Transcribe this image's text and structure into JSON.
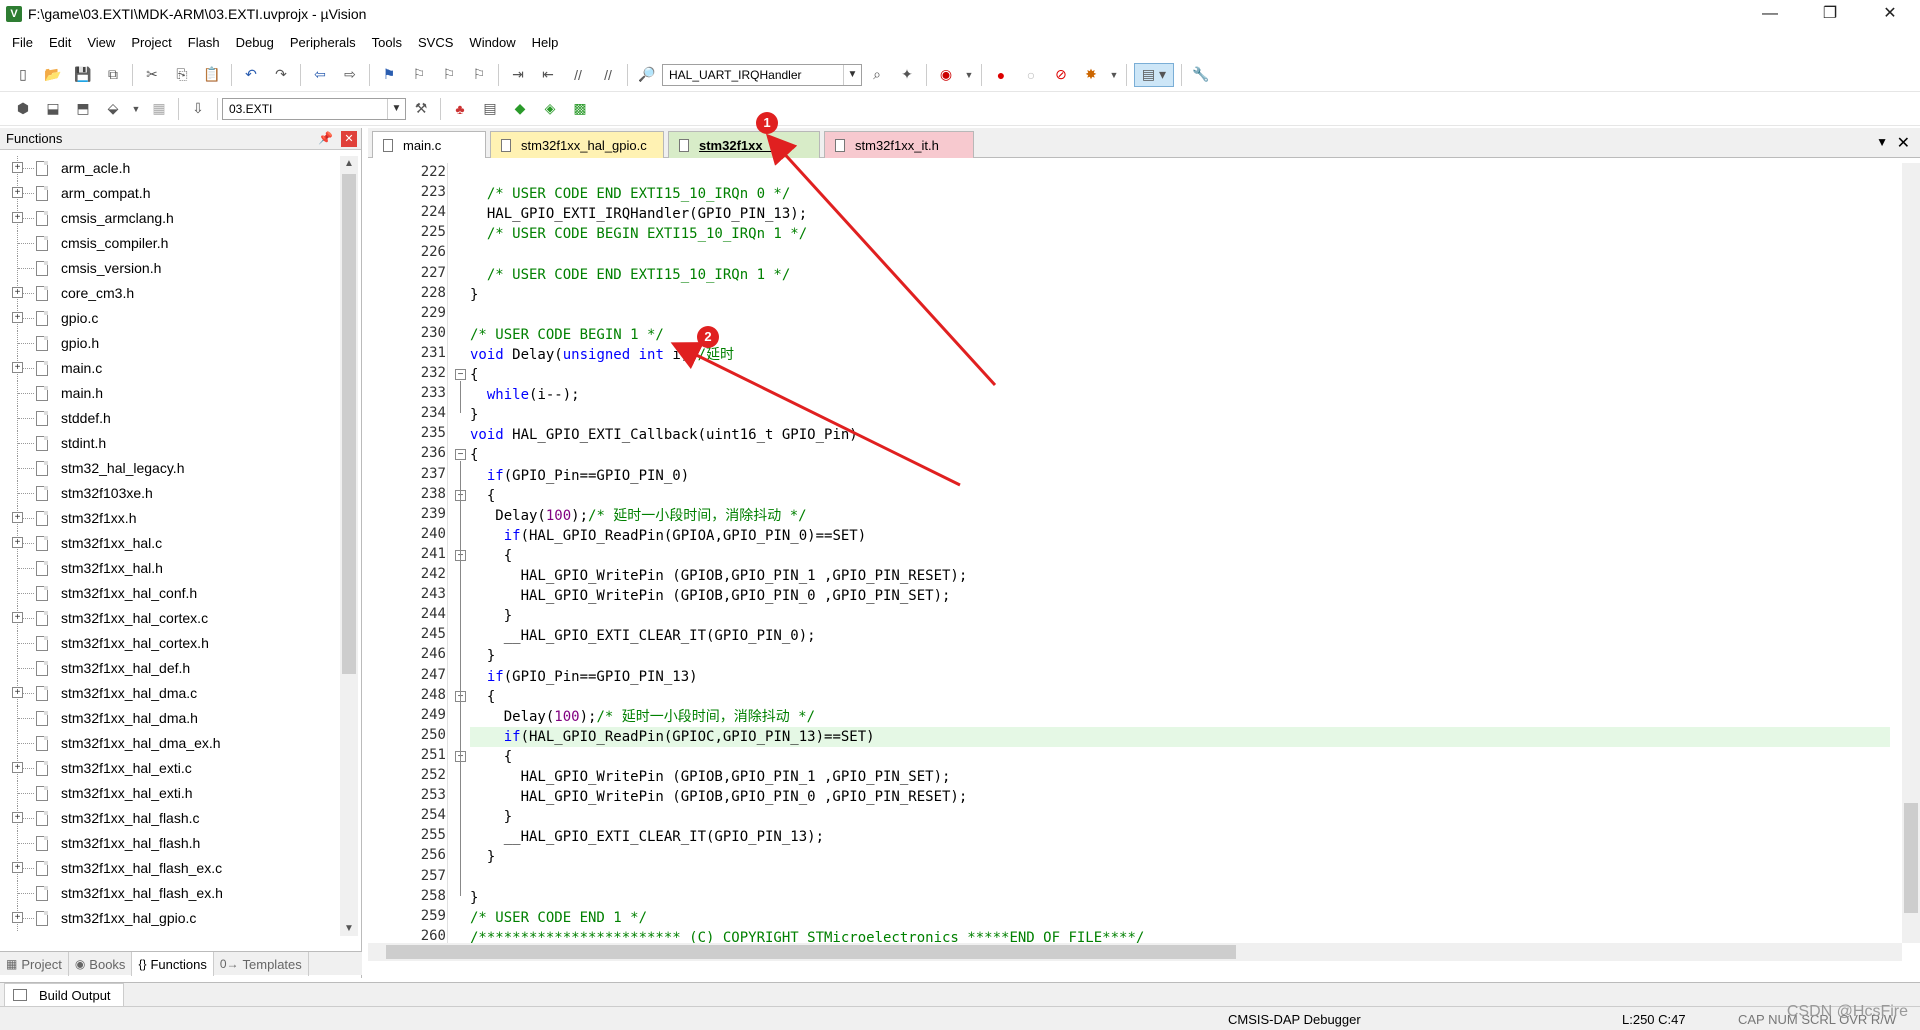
{
  "window": {
    "title": "F:\\game\\03.EXTI\\MDK-ARM\\03.EXTI.uvprojx - µVision",
    "app_icon_letter": "V",
    "minimize": "—",
    "maximize": "❐",
    "close": "✕"
  },
  "menu": [
    "File",
    "Edit",
    "View",
    "Project",
    "Flash",
    "Debug",
    "Peripherals",
    "Tools",
    "SVCS",
    "Window",
    "Help"
  ],
  "toolbar": {
    "function_combo": "HAL_UART_IRQHandler",
    "target_combo": "03.EXTI"
  },
  "left_panel": {
    "title": "Functions",
    "items": [
      {
        "label": "arm_acle.h",
        "expandable": true
      },
      {
        "label": "arm_compat.h",
        "expandable": true
      },
      {
        "label": "cmsis_armclang.h",
        "expandable": true
      },
      {
        "label": "cmsis_compiler.h",
        "expandable": false
      },
      {
        "label": "cmsis_version.h",
        "expandable": false
      },
      {
        "label": "core_cm3.h",
        "expandable": true
      },
      {
        "label": "gpio.c",
        "expandable": true
      },
      {
        "label": "gpio.h",
        "expandable": false
      },
      {
        "label": "main.c",
        "expandable": true
      },
      {
        "label": "main.h",
        "expandable": false
      },
      {
        "label": "stddef.h",
        "expandable": false
      },
      {
        "label": "stdint.h",
        "expandable": false
      },
      {
        "label": "stm32_hal_legacy.h",
        "expandable": false
      },
      {
        "label": "stm32f103xe.h",
        "expandable": false
      },
      {
        "label": "stm32f1xx.h",
        "expandable": true
      },
      {
        "label": "stm32f1xx_hal.c",
        "expandable": true
      },
      {
        "label": "stm32f1xx_hal.h",
        "expandable": false
      },
      {
        "label": "stm32f1xx_hal_conf.h",
        "expandable": false
      },
      {
        "label": "stm32f1xx_hal_cortex.c",
        "expandable": true
      },
      {
        "label": "stm32f1xx_hal_cortex.h",
        "expandable": false
      },
      {
        "label": "stm32f1xx_hal_def.h",
        "expandable": false
      },
      {
        "label": "stm32f1xx_hal_dma.c",
        "expandable": true
      },
      {
        "label": "stm32f1xx_hal_dma.h",
        "expandable": false
      },
      {
        "label": "stm32f1xx_hal_dma_ex.h",
        "expandable": false
      },
      {
        "label": "stm32f1xx_hal_exti.c",
        "expandable": true
      },
      {
        "label": "stm32f1xx_hal_exti.h",
        "expandable": false
      },
      {
        "label": "stm32f1xx_hal_flash.c",
        "expandable": true
      },
      {
        "label": "stm32f1xx_hal_flash.h",
        "expandable": false
      },
      {
        "label": "stm32f1xx_hal_flash_ex.c",
        "expandable": true
      },
      {
        "label": "stm32f1xx_hal_flash_ex.h",
        "expandable": false
      },
      {
        "label": "stm32f1xx_hal_gpio.c",
        "expandable": true
      }
    ],
    "tabs": [
      {
        "icon": "▦",
        "label": "Project"
      },
      {
        "icon": "◉",
        "label": "Books"
      },
      {
        "icon": "{}",
        "label": "Functions"
      },
      {
        "icon": "0→",
        "label": "Templates"
      }
    ]
  },
  "editor": {
    "tabs": [
      {
        "label": "main.c",
        "bg": "#ffffff",
        "active": false
      },
      {
        "label": "stm32f1xx_hal_gpio.c",
        "bg": "#fff2b3",
        "active": false
      },
      {
        "label": "stm32f1xx_it.c",
        "bg": "#d8ecc8",
        "active": true
      },
      {
        "label": "stm32f1xx_it.h",
        "bg": "#f7c9cf",
        "active": false
      }
    ],
    "lines": [
      {
        "n": "222",
        "parts": []
      },
      {
        "n": "223",
        "parts": [
          [
            "cm",
            "  /* USER CODE END EXTI15_10_IRQn 0 */"
          ]
        ]
      },
      {
        "n": "224",
        "parts": [
          [
            "",
            "  HAL_GPIO_EXTI_IRQHandler(GPIO_PIN_13);"
          ]
        ]
      },
      {
        "n": "225",
        "parts": [
          [
            "cm",
            "  /* USER CODE BEGIN EXTI15_10_IRQn 1 */"
          ]
        ]
      },
      {
        "n": "226",
        "parts": []
      },
      {
        "n": "227",
        "parts": [
          [
            "cm",
            "  /* USER CODE END EXTI15_10_IRQn 1 */"
          ]
        ]
      },
      {
        "n": "228",
        "parts": [
          [
            "",
            "}"
          ]
        ]
      },
      {
        "n": "229",
        "parts": []
      },
      {
        "n": "230",
        "parts": [
          [
            "cm",
            "/* USER CODE BEGIN 1 */"
          ]
        ]
      },
      {
        "n": "231",
        "parts": [
          [
            "kw",
            "void"
          ],
          [
            "",
            " Delay("
          ],
          [
            "kw",
            "unsigned"
          ],
          [
            "",
            " "
          ],
          [
            "kw",
            "int"
          ],
          [
            "",
            " i)"
          ],
          [
            "cm",
            "//延时"
          ]
        ]
      },
      {
        "n": "232",
        "parts": [
          [
            "",
            "{"
          ]
        ]
      },
      {
        "n": "233",
        "parts": [
          [
            "",
            "  "
          ],
          [
            "kw",
            "while"
          ],
          [
            "",
            "(i--);"
          ]
        ]
      },
      {
        "n": "234",
        "parts": [
          [
            "",
            "}"
          ]
        ]
      },
      {
        "n": "235",
        "parts": [
          [
            "kw",
            "void"
          ],
          [
            "",
            " HAL_GPIO_EXTI_Callback(uint16_t GPIO_Pin)"
          ]
        ]
      },
      {
        "n": "236",
        "parts": [
          [
            "",
            "{"
          ]
        ]
      },
      {
        "n": "237",
        "parts": [
          [
            "",
            "  "
          ],
          [
            "kw",
            "if"
          ],
          [
            "",
            "(GPIO_Pin==GPIO_PIN_0)"
          ]
        ]
      },
      {
        "n": "238",
        "parts": [
          [
            "",
            "  {"
          ]
        ]
      },
      {
        "n": "239",
        "parts": [
          [
            "",
            "   Delay("
          ],
          [
            "num",
            "100"
          ],
          [
            "",
            ");"
          ],
          [
            "cm",
            "/* 延时一小段时间，消除抖动 */"
          ]
        ]
      },
      {
        "n": "240",
        "parts": [
          [
            "",
            "    "
          ],
          [
            "kw",
            "if"
          ],
          [
            "",
            "(HAL_GPIO_ReadPin(GPIOA,GPIO_PIN_0)==SET)"
          ]
        ]
      },
      {
        "n": "241",
        "parts": [
          [
            "",
            "    {"
          ]
        ]
      },
      {
        "n": "242",
        "parts": [
          [
            "",
            "      HAL_GPIO_WritePin (GPIOB,GPIO_PIN_1 ,GPIO_PIN_RESET);"
          ]
        ]
      },
      {
        "n": "243",
        "parts": [
          [
            "",
            "      HAL_GPIO_WritePin (GPIOB,GPIO_PIN_0 ,GPIO_PIN_SET);"
          ]
        ]
      },
      {
        "n": "244",
        "parts": [
          [
            "",
            "    }"
          ]
        ]
      },
      {
        "n": "245",
        "parts": [
          [
            "",
            "    __HAL_GPIO_EXTI_CLEAR_IT(GPIO_PIN_0);"
          ]
        ]
      },
      {
        "n": "246",
        "parts": [
          [
            "",
            "  }"
          ]
        ]
      },
      {
        "n": "247",
        "parts": [
          [
            "",
            "  "
          ],
          [
            "kw",
            "if"
          ],
          [
            "",
            "(GPIO_Pin==GPIO_PIN_13)"
          ]
        ]
      },
      {
        "n": "248",
        "parts": [
          [
            "",
            "  {"
          ]
        ]
      },
      {
        "n": "249",
        "parts": [
          [
            "",
            "    Delay("
          ],
          [
            "num",
            "100"
          ],
          [
            "",
            ");"
          ],
          [
            "cm",
            "/* 延时一小段时间，消除抖动 */"
          ]
        ]
      },
      {
        "n": "250",
        "parts": [
          [
            "",
            "    "
          ],
          [
            "kw",
            "if"
          ],
          [
            "",
            "(HAL_GPIO_ReadPin(GPIOC,GPIO_PIN_13)==SET)"
          ]
        ]
      },
      {
        "n": "251",
        "parts": [
          [
            "",
            "    {"
          ]
        ]
      },
      {
        "n": "252",
        "parts": [
          [
            "",
            "      HAL_GPIO_WritePin (GPIOB,GPIO_PIN_1 ,GPIO_PIN_SET);"
          ]
        ]
      },
      {
        "n": "253",
        "parts": [
          [
            "",
            "      HAL_GPIO_WritePin (GPIOB,GPIO_PIN_0 ,GPIO_PIN_RESET);"
          ]
        ]
      },
      {
        "n": "254",
        "parts": [
          [
            "",
            "    }"
          ]
        ]
      },
      {
        "n": "255",
        "parts": [
          [
            "",
            "    __HAL_GPIO_EXTI_CLEAR_IT(GPIO_PIN_13);"
          ]
        ]
      },
      {
        "n": "256",
        "parts": [
          [
            "",
            "  }"
          ]
        ]
      },
      {
        "n": "257",
        "parts": []
      },
      {
        "n": "258",
        "parts": [
          [
            "",
            "}"
          ]
        ]
      },
      {
        "n": "259",
        "parts": [
          [
            "cm",
            "/* USER CODE END 1 */"
          ]
        ]
      },
      {
        "n": "260",
        "parts": [
          [
            "cm",
            "/************************ (C) COPYRIGHT STMicroelectronics *****END OF FILE****/"
          ]
        ]
      }
    ],
    "highlighted_line": "250"
  },
  "build_output": {
    "label": "Build Output"
  },
  "status": {
    "debugger": "CMSIS-DAP Debugger",
    "position": "L:250 C:47",
    "flags": "CAP  NUM  SCRL  OVR  R/W"
  },
  "annotations": {
    "badge1": "1",
    "badge2": "2",
    "color": "#e02020"
  },
  "watermark": "CSDN @HcsFire"
}
